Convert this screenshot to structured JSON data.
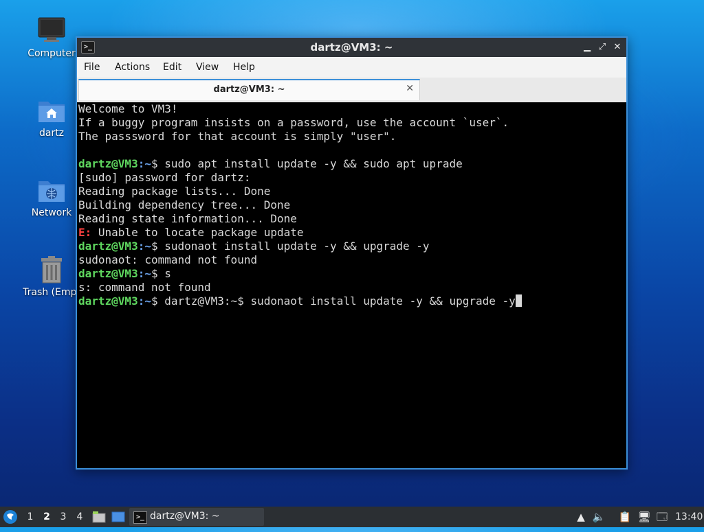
{
  "desktop": {
    "icons": [
      {
        "label": "Computer",
        "icon": "computer-monitor-icon"
      },
      {
        "label": "dartz",
        "icon": "home-folder-icon"
      },
      {
        "label": "Network",
        "icon": "network-folder-icon"
      },
      {
        "label": "Trash (Empt",
        "icon": "trash-icon"
      }
    ]
  },
  "window": {
    "title": "dartz@VM3: ~",
    "controls": {
      "minimize": "minimize-icon",
      "maximize": "maximize-icon",
      "close": "close-icon"
    },
    "menu": [
      "File",
      "Actions",
      "Edit",
      "View",
      "Help"
    ],
    "tab": {
      "label": "dartz@VM3: ~"
    }
  },
  "terminal": {
    "welcome": [
      "Welcome to VM3!",
      "If a buggy program insists on a password, use the account `user`.",
      "The passsword for that account is simply \"user\"."
    ],
    "prompt_user": "dartz@VM3",
    "prompt_path": ":~",
    "prompt_symbol": "$ ",
    "cmd1": "sudo apt install update -y && sudo apt uprade",
    "out1": [
      "[sudo] password for dartz:",
      "Reading package lists... Done",
      "Building dependency tree... Done",
      "Reading state information... Done"
    ],
    "err_label": "E:",
    "err_text": " Unable to locate package update",
    "cmd2": "sudonaot install update -y && upgrade -y",
    "out2": "sudonaot: command not found",
    "cmd3": "s",
    "out3": "s: command not found",
    "cmd4": "dartz@VM3:~$ sudonaot install update -y && upgrade -y"
  },
  "taskbar": {
    "start_icon": "start-menu-icon",
    "workspaces": [
      "1",
      "2",
      "3",
      "4"
    ],
    "active_workspace": "2",
    "task_label": "dartz@VM3: ~",
    "clock": "13:40"
  }
}
